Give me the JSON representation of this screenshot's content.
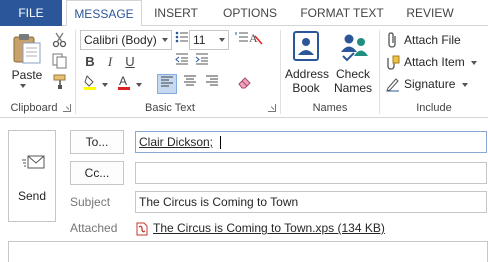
{
  "tabs": {
    "file": "FILE",
    "message": "MESSAGE",
    "insert": "INSERT",
    "options": "OPTIONS",
    "format_text": "FORMAT TEXT",
    "review": "REVIEW"
  },
  "clipboard": {
    "paste_label": "Paste",
    "group_label": "Clipboard"
  },
  "basic_text": {
    "font_name": "Calibri (Body)",
    "font_size": "11",
    "group_label": "Basic Text"
  },
  "names": {
    "address_book_line1": "Address",
    "address_book_line2": "Book",
    "check_names_line1": "Check",
    "check_names_line2": "Names",
    "group_label": "Names"
  },
  "include": {
    "attach_file": "Attach File",
    "attach_item": "Attach Item",
    "signature": "Signature",
    "group_label": "Include"
  },
  "compose": {
    "send_label": "Send",
    "to_button": "To...",
    "cc_button": "Cc...",
    "to_value": "Clair Dickson;",
    "cc_value": "",
    "subject_label": "Subject",
    "subject_value": "The Circus is Coming to Town",
    "attached_label": "Attached",
    "attachment_name": "The Circus is Coming to Town.xps (134 KB)"
  },
  "colors": {
    "accent": "#2b579a",
    "highlight_yellow": "#ffff00",
    "font_red": "#e02020",
    "pressed_bg": "#c5d9f1"
  }
}
